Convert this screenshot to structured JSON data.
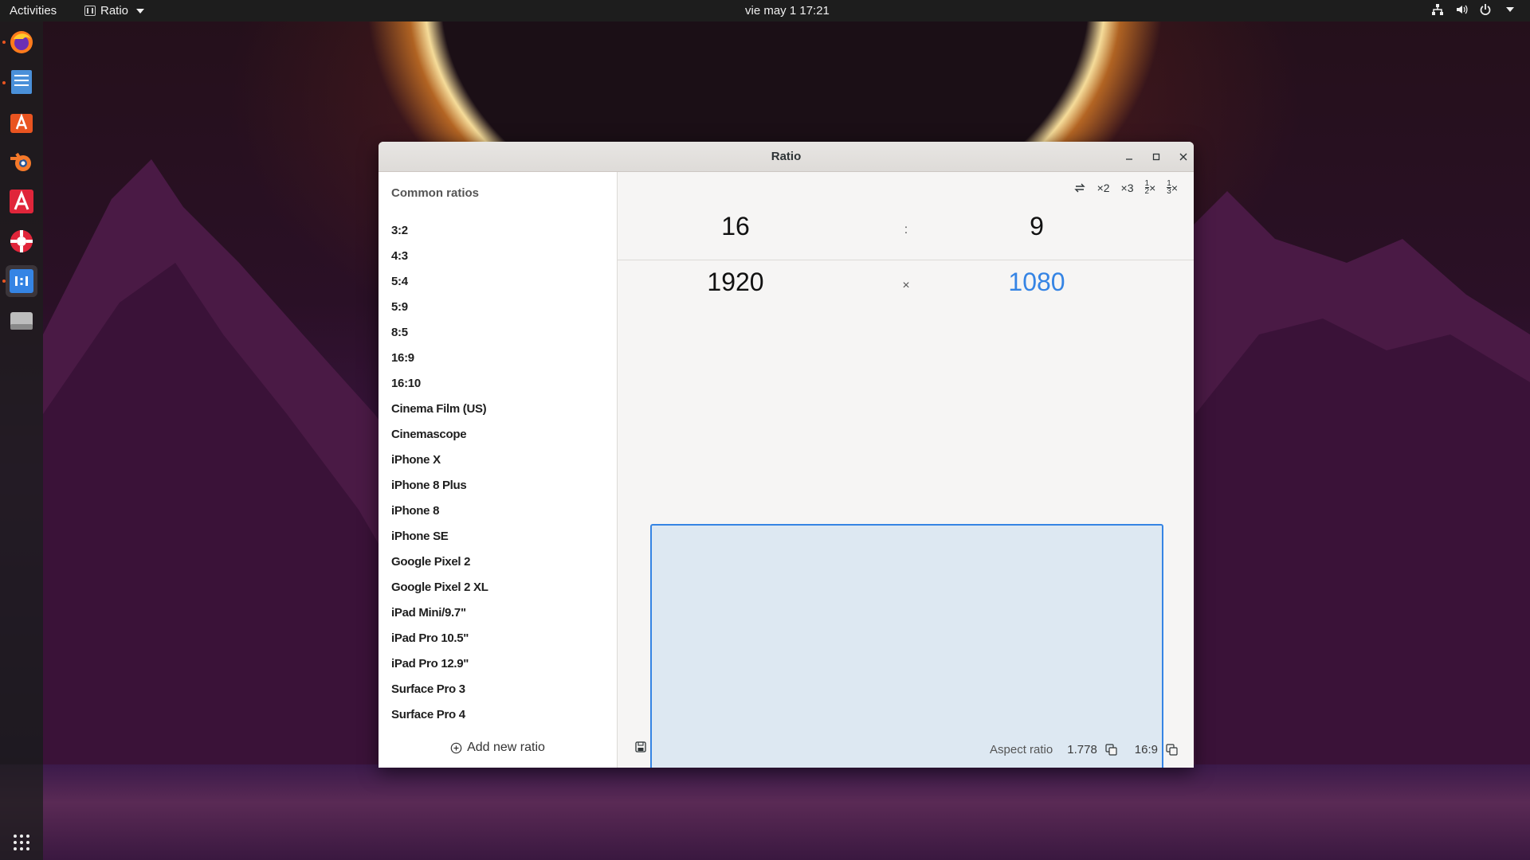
{
  "topbar": {
    "activities": "Activities",
    "app_name": "Ratio",
    "clock": "vie may 1  17:21"
  },
  "dock": {
    "items": [
      "firefox-icon",
      "files-icon",
      "software-icon",
      "blender-icon",
      "a-icon",
      "help-icon",
      "ratio-icon",
      "drive-icon",
      "apps-grid-icon"
    ]
  },
  "window": {
    "title": "Ratio"
  },
  "sidebar": {
    "header": "Common ratios",
    "items": [
      "3:2",
      "4:3",
      "5:4",
      "5:9",
      "8:5",
      "16:9",
      "16:10",
      "Cinema Film (US)",
      "Cinemascope",
      "iPhone X",
      "iPhone 8 Plus",
      "iPhone 8",
      "iPhone SE",
      "Google Pixel 2",
      "Google Pixel 2 XL",
      "iPad Mini/9.7\"",
      "iPad Pro 10.5\"",
      "iPad Pro 12.9\"",
      "Surface Pro 3",
      "Surface Pro 4"
    ],
    "add_label": "Add new ratio"
  },
  "toolbar": {
    "swap_icon": "swap-icon",
    "x2": "×2",
    "x3": "×3",
    "half_num": "1",
    "half_den": "2",
    "third_num": "1",
    "third_den": "3",
    "times": "×"
  },
  "ratio": {
    "left": "16",
    "separator": ":",
    "right": "9"
  },
  "resolution": {
    "width": "1920",
    "separator": "×",
    "height": "1080"
  },
  "footer": {
    "aspect_label": "Aspect ratio",
    "decimal": "1.778",
    "ratio": "16:9"
  },
  "colors": {
    "accent": "#3584e4",
    "preview_fill": "#dde8f2"
  }
}
